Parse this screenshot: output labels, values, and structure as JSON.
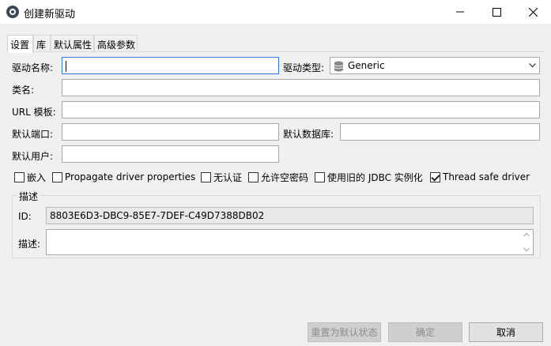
{
  "window": {
    "title": "创建新驱动"
  },
  "tabs": [
    {
      "label": "设置",
      "active": true
    },
    {
      "label": "库",
      "active": false
    },
    {
      "label": "默认属性",
      "active": false
    },
    {
      "label": "高级参数",
      "active": false
    }
  ],
  "form": {
    "driver_name_label": "驱动名称:",
    "driver_name_value": "",
    "driver_type_label": "驱动类型:",
    "driver_type_value": "Generic",
    "class_name_label": "类名:",
    "class_name_value": "",
    "url_template_label": "URL 模板:",
    "url_template_value": "",
    "default_port_label": "默认端口:",
    "default_port_value": "",
    "default_db_label": "默认数据库:",
    "default_db_value": "",
    "default_user_label": "默认用户:",
    "default_user_value": ""
  },
  "checkboxes": [
    {
      "label": "嵌入",
      "checked": false
    },
    {
      "label": "Propagate driver properties",
      "checked": false
    },
    {
      "label": "无认证",
      "checked": false
    },
    {
      "label": "允许空密码",
      "checked": false
    },
    {
      "label": "使用旧的 JDBC 实例化",
      "checked": false
    },
    {
      "label": "Thread safe driver",
      "checked": true
    }
  ],
  "description_group": {
    "title": "描述",
    "id_label": "ID:",
    "id_value": "8803E6D3-DBC9-85E7-7DEF-C49D7388DB02",
    "desc_label": "描述:",
    "desc_value": ""
  },
  "buttons": {
    "reset": "重置为默认状态",
    "ok": "确定",
    "cancel": "取消"
  },
  "colors": {
    "focus_border": "#2b7bd6",
    "dialog_bg": "#f0f0f0"
  }
}
